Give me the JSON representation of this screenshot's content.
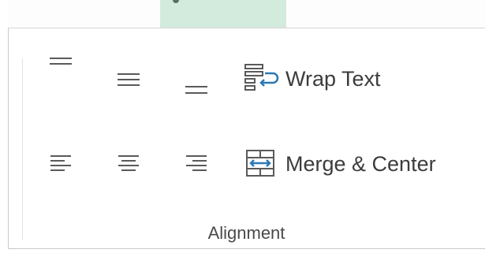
{
  "ribbon": {
    "group_label": "Alignment",
    "wrap_text_label": "Wrap Text",
    "merge_center_label": "Merge & Center",
    "icons": {
      "top_align": "align-top-icon",
      "middle_align": "align-middle-icon",
      "bottom_align": "align-bottom-icon",
      "wrap_text": "wrap-text-icon",
      "align_left": "align-left-icon",
      "center": "align-center-icon",
      "align_right": "align-right-icon",
      "merge_center": "merge-center-icon"
    },
    "colors": {
      "icon_gray": "#5a5a5a",
      "icon_blue": "#2b79b5",
      "tab_highlight": "#d3ebdd"
    }
  }
}
